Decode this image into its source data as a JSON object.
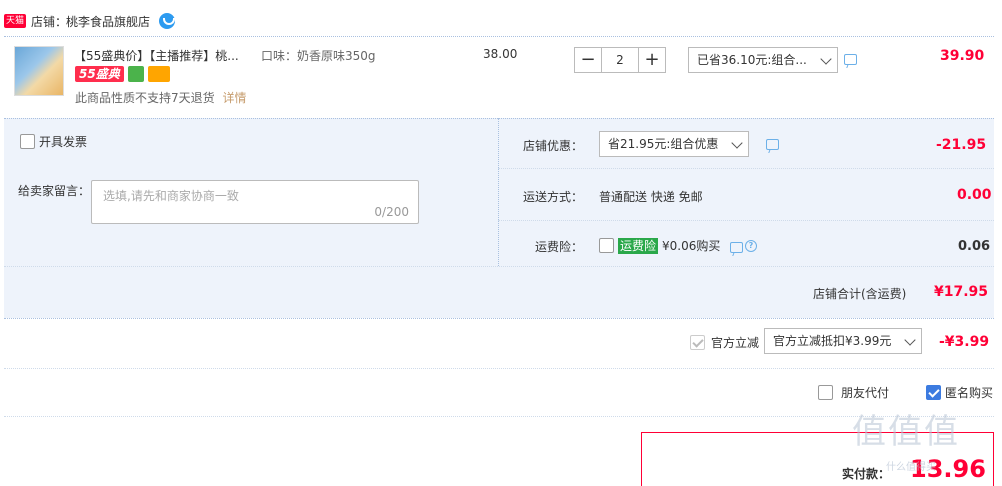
{
  "store": {
    "badge": "天猫",
    "label": "店铺：",
    "name": "桃李食品旗舰店"
  },
  "item": {
    "title": "【55盛典价】【主播推荐】桃...",
    "tag_55": "55盛典",
    "spec": "口味：奶香原味350g",
    "unit_price": "38.00",
    "quantity": "2",
    "discount_select": "已省36.10元:组合...",
    "subtotal": "39.90",
    "notice": "此商品性质不支持7天退货",
    "detail_link": "详情"
  },
  "invoice": {
    "label": "开具发票"
  },
  "message": {
    "label": "给卖家留言：",
    "placeholder": "选填,请先和商家协商一致",
    "counter": "0/200"
  },
  "store_discount": {
    "label": "店铺优惠：",
    "select": "省21.95元:组合优惠",
    "amount": "-21.95"
  },
  "shipping": {
    "label": "运送方式：",
    "method": "普通配送 快递 免邮",
    "amount": "0.00"
  },
  "insurance": {
    "label": "运费险：",
    "tag": "运费险",
    "price_text": "¥0.06购买",
    "amount": "0.06"
  },
  "store_total": {
    "label": "店铺合计(含运费)",
    "amount": "¥17.95"
  },
  "official": {
    "label": "官方立减",
    "select": "官方立减抵扣¥3.99元",
    "amount": "-¥3.99"
  },
  "options": {
    "friend_pay": "朋友代付",
    "anonymous": "匿名购买"
  },
  "payment": {
    "label": "实付款：",
    "amount": "13.96"
  },
  "watermark": {
    "text": "值值值",
    "sub": "什么值得买"
  },
  "colors": {
    "accent_red": "#ff0036",
    "section_bg": "#eef3fb",
    "link_blue": "#3c7be0"
  }
}
